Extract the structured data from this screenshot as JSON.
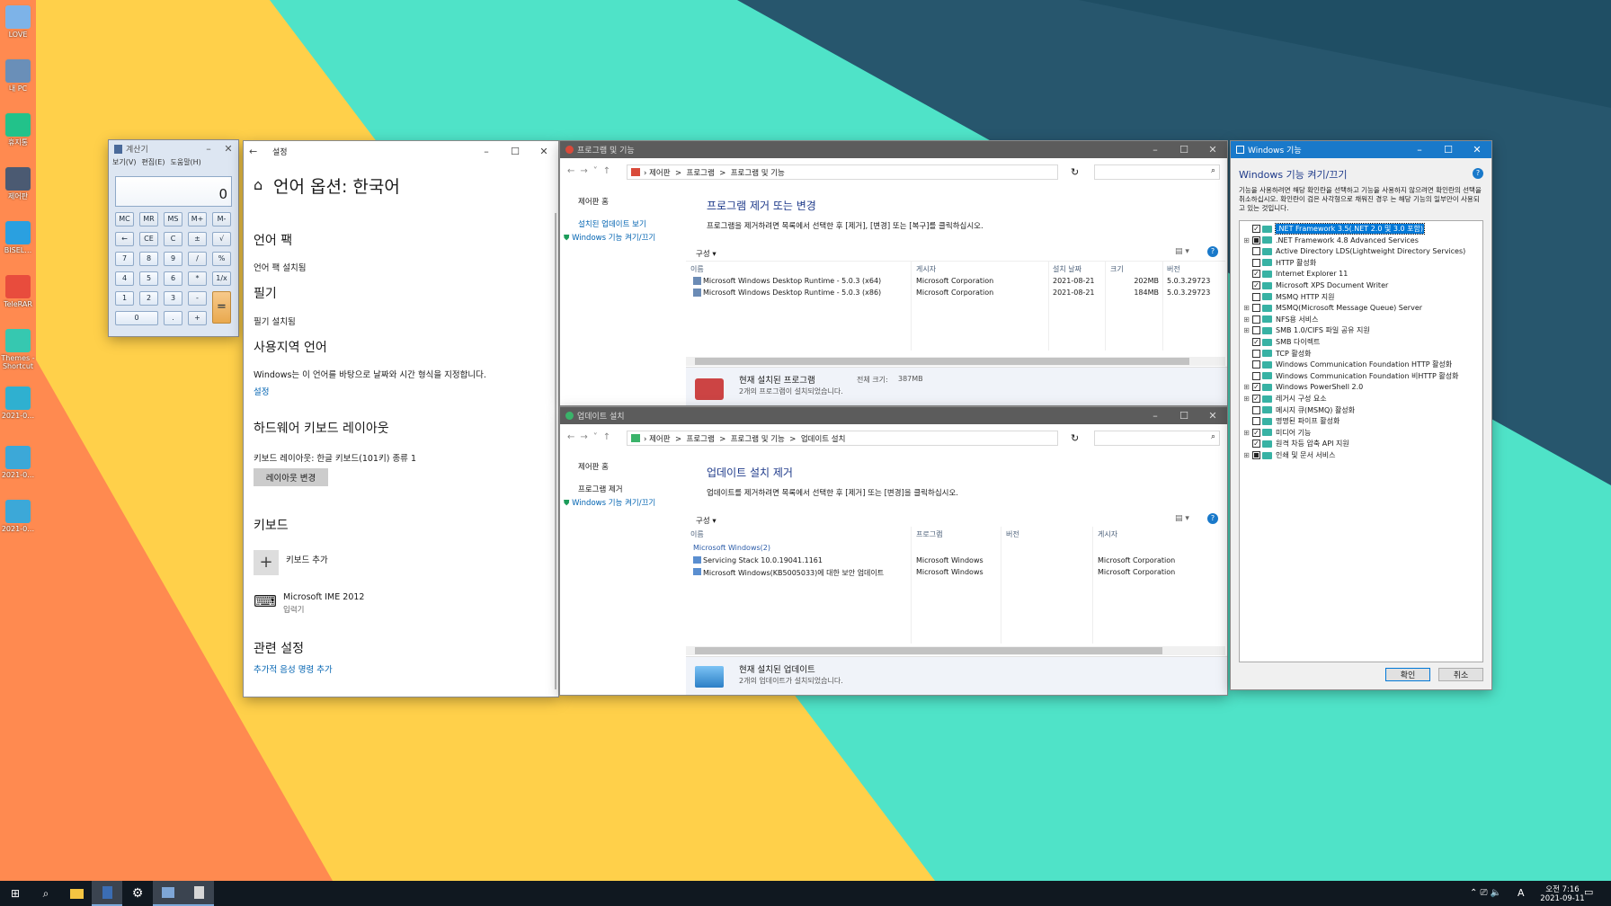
{
  "desktop": {
    "icons": [
      "LOVE",
      "내 PC",
      "휴지통",
      "제어판",
      "BISEL…",
      "TeleRAR",
      "Themes - Shortcut",
      "2021-0…",
      "2021-0…",
      "2021-0…"
    ]
  },
  "calc": {
    "title": "계산기",
    "menu": [
      "보기(V)",
      "편집(E)",
      "도움말(H)"
    ],
    "display": "0",
    "keys": [
      [
        "MC",
        "MR",
        "MS",
        "M+",
        "M-"
      ],
      [
        "←",
        "CE",
        "C",
        "±",
        "√"
      ],
      [
        "7",
        "8",
        "9",
        "/",
        "%"
      ],
      [
        "4",
        "5",
        "6",
        "*",
        "1/x"
      ],
      [
        "1",
        "2",
        "3",
        "-",
        "="
      ],
      [
        "0",
        ".",
        "+"
      ]
    ]
  },
  "settings": {
    "title": "설정",
    "page_title": "언어 옵션: 한국어",
    "s1": "언어 팩",
    "s1_text": "언어 팩 설치됨",
    "s2": "필기",
    "s2_text": "필기 설치됨",
    "s3": "사용지역 언어",
    "s3_text": "Windows는 이 언어를 바탕으로 날짜와 시간 형식을 지정합니다.",
    "s3_link": "설정",
    "s4": "하드웨어 키보드 레이아웃",
    "s4_text": "키보드 레이아웃:  한글 키보드(101키) 종류 1",
    "s4_btn": "레이아웃 변경",
    "s5": "키보드",
    "add_kb": "키보드 추가",
    "ime_name": "Microsoft IME 2012",
    "ime_sub": "입력기",
    "s6": "관련 설정",
    "s6_link": "추가적 음성 명령 추가"
  },
  "programs": {
    "title": "프로그램 및 기능",
    "crumbs": [
      "제어판",
      ">",
      "프로그램",
      ">",
      "프로그램 및 기능"
    ],
    "side": [
      "제어판 홈",
      "설치된 업데이트 보기",
      "Windows 기능 켜기/끄기"
    ],
    "heading": "프로그램 제거 또는 변경",
    "desc": "프로그램을 제거하려면 목록에서 선택한 후 [제거], [변경] 또는 [복구]를 클릭하십시오.",
    "organize": "구성 ▾",
    "cols": [
      "이름",
      "게시자",
      "설치 날짜",
      "크기",
      "버전"
    ],
    "rows": [
      [
        "Microsoft Windows Desktop Runtime - 5.0.3 (x64)",
        "Microsoft Corporation",
        "2021-08-21",
        "202MB",
        "5.0.3.29723"
      ],
      [
        "Microsoft Windows Desktop Runtime - 5.0.3 (x86)",
        "Microsoft Corporation",
        "2021-08-21",
        "184MB",
        "5.0.3.29723"
      ]
    ],
    "footer_title": "현재 설치된 프로그램",
    "footer_size_label": "전체 크기:",
    "footer_size": "387MB",
    "footer_count": "2개의 프로그램이 설치되었습니다."
  },
  "updates": {
    "title": "업데이트 설치",
    "crumbs": [
      "제어판",
      ">",
      "프로그램",
      ">",
      "프로그램 및 기능",
      ">",
      "업데이트 설치"
    ],
    "side": [
      "제어판 홈",
      "프로그램 제거",
      "Windows 기능 켜기/끄기"
    ],
    "heading": "업데이트 설치 제거",
    "desc": "업데이트를 제거하려면 목록에서 선택한 후 [제거] 또는 [변경]을 클릭하십시오.",
    "organize": "구성 ▾",
    "cols": [
      "이름",
      "프로그램",
      "버전",
      "게시자"
    ],
    "group": "Microsoft Windows(2)",
    "rows": [
      [
        "Servicing Stack 10.0.19041.1161",
        "Microsoft Windows",
        "",
        "Microsoft Corporation"
      ],
      [
        "Microsoft Windows(KB5005033)에 대한 보안 업데이트",
        "Microsoft Windows",
        "",
        "Microsoft Corporation"
      ]
    ],
    "footer_title": "현재 설치된 업데이트",
    "footer_count": "2개의 업데이트가 설치되었습니다."
  },
  "features": {
    "title": "Windows 기능",
    "heading": "Windows 기능 켜기/끄기",
    "desc": "기능을 사용하려면 해당 확인란을 선택하고 기능을 사용하지 않으려면 확인란의 선택을 취소하십시오. 확인란이 검은 사각형으로 채워진 경우 는 해당 기능의 일부만이 사용되고 있는 것입니다.",
    "items": [
      {
        "label": ".NET Framework 3.5(.NET 2.0 및 3.0 포함)",
        "state": "checked",
        "expand": false,
        "selected": true
      },
      {
        "label": ".NET Framework 4.8 Advanced Services",
        "state": "partial",
        "expand": true
      },
      {
        "label": "Active Directory LDS(Lightweight Directory Services)",
        "state": "off",
        "expand": false
      },
      {
        "label": "HTTP 활성화",
        "state": "off",
        "expand": false
      },
      {
        "label": "Internet Explorer 11",
        "state": "checked",
        "expand": false
      },
      {
        "label": "Microsoft XPS Document Writer",
        "state": "checked",
        "expand": false
      },
      {
        "label": "MSMQ HTTP 지원",
        "state": "off",
        "expand": false
      },
      {
        "label": "MSMQ(Microsoft Message Queue) Server",
        "state": "off",
        "expand": true
      },
      {
        "label": "NFS용 서비스",
        "state": "off",
        "expand": true
      },
      {
        "label": "SMB 1.0/CIFS 파일 공유 지원",
        "state": "off",
        "expand": true
      },
      {
        "label": "SMB 다이렉트",
        "state": "checked",
        "expand": false
      },
      {
        "label": "TCP 활성화",
        "state": "off",
        "expand": false
      },
      {
        "label": "Windows Communication Foundation HTTP 활성화",
        "state": "off",
        "expand": false
      },
      {
        "label": "Windows Communication Foundation 비HTTP 활성화",
        "state": "off",
        "expand": false
      },
      {
        "label": "Windows PowerShell 2.0",
        "state": "checked",
        "expand": true
      },
      {
        "label": "레거시 구성 요소",
        "state": "checked",
        "expand": true
      },
      {
        "label": "메시지 큐(MSMQ) 활성화",
        "state": "off",
        "expand": false
      },
      {
        "label": "명명된 파이프 활성화",
        "state": "off",
        "expand": false
      },
      {
        "label": "미디어 기능",
        "state": "checked",
        "expand": true
      },
      {
        "label": "원격 차등 압축 API 지원",
        "state": "checked",
        "expand": false
      },
      {
        "label": "인쇄 및 문서 서비스",
        "state": "partial",
        "expand": true
      }
    ],
    "ok": "확인",
    "cancel": "취소"
  },
  "taskbar": {
    "time": "오전 7:16",
    "date": "2021-09-11",
    "lang": "A"
  }
}
